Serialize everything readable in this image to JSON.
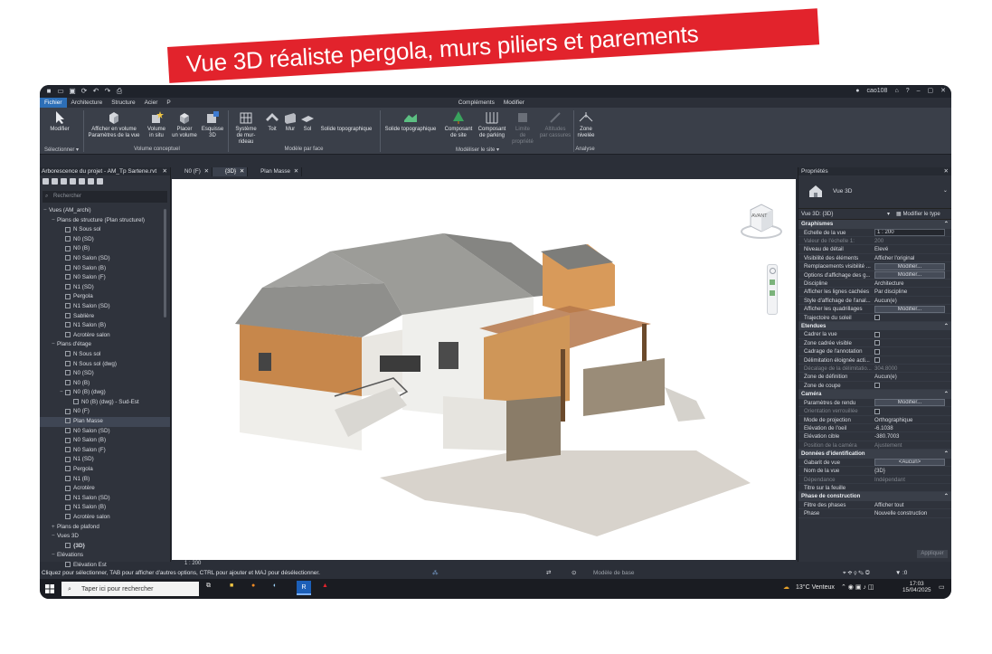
{
  "banner": {
    "text": "Vue 3D réaliste pergola, murs piliers et parements"
  },
  "titlebar": {
    "user": "cao108"
  },
  "ribbon": {
    "tabs": [
      "Fichier",
      "Architecture",
      "Structure",
      "Acier",
      "P",
      "Compléments",
      "Modifier"
    ],
    "buttons": {
      "modifier": "Modifier",
      "afficher_volume": "Afficher en volume",
      "parametres_vue": "Paramètres de la vue",
      "volume_in_situ_1": "Volume",
      "volume_in_situ_2": "in situ",
      "placer_volume_1": "Placer",
      "placer_volume_2": "un volume",
      "esquisse_1": "Esquisse",
      "esquisse_2": "3D",
      "systeme_1": "Système",
      "systeme_2": "de mur-rideau",
      "toit": "Toit",
      "mur": "Mur",
      "sol": "Sol",
      "solide_topo": "Solide topographique",
      "solide_topo2": "Solide topographique",
      "composant_site_1": "Composant",
      "composant_site_2": "de site",
      "composant_parking_1": "Composant",
      "composant_parking_2": "de parking",
      "limite_1": "Limite",
      "limite_2": "de propriété",
      "altitudes_1": "Altitudes",
      "altitudes_2": "par cassures",
      "zone_1": "Zone",
      "zone_2": "nivelée"
    },
    "groups": {
      "selectionner": "Sélectionner ▾",
      "volume_conceptuel": "Volume conceptuel",
      "modele_par_face": "Modèle par face",
      "modeliser_site": "Modéliser le site ▾",
      "analyse": "Analyse"
    }
  },
  "browser": {
    "title": "Arborescence du projet - AM_Tp Sartene.rvt",
    "search_placeholder": "Rechercher",
    "items": [
      {
        "indent": 0,
        "toggle": "−",
        "label": "Vues (AM_archi)",
        "box": false
      },
      {
        "indent": 1,
        "toggle": "−",
        "label": "Plans de structure (Plan structurel)",
        "box": false
      },
      {
        "indent": 2,
        "toggle": "",
        "label": "N Sous sol",
        "box": true
      },
      {
        "indent": 2,
        "toggle": "",
        "label": "N0 (SD)",
        "box": true
      },
      {
        "indent": 2,
        "toggle": "",
        "label": "N0 (B)",
        "box": true
      },
      {
        "indent": 2,
        "toggle": "",
        "label": "N0 Salon (SD)",
        "box": true
      },
      {
        "indent": 2,
        "toggle": "",
        "label": "N0 Salon (B)",
        "box": true
      },
      {
        "indent": 2,
        "toggle": "",
        "label": "N0 Salon (F)",
        "box": true
      },
      {
        "indent": 2,
        "toggle": "",
        "label": "N1 (SD)",
        "box": true
      },
      {
        "indent": 2,
        "toggle": "",
        "label": "Pergola",
        "box": true
      },
      {
        "indent": 2,
        "toggle": "",
        "label": "N1 Salon (SD)",
        "box": true
      },
      {
        "indent": 2,
        "toggle": "",
        "label": "Sablière",
        "box": true
      },
      {
        "indent": 2,
        "toggle": "",
        "label": "N1 Salon (B)",
        "box": true
      },
      {
        "indent": 2,
        "toggle": "",
        "label": "Acrotère salon",
        "box": true
      },
      {
        "indent": 1,
        "toggle": "−",
        "label": "Plans d'étage",
        "box": false
      },
      {
        "indent": 2,
        "toggle": "",
        "label": "N Sous sol",
        "box": true
      },
      {
        "indent": 2,
        "toggle": "",
        "label": "N Sous sol (dwg)",
        "box": true
      },
      {
        "indent": 2,
        "toggle": "",
        "label": "N0 (SD)",
        "box": true
      },
      {
        "indent": 2,
        "toggle": "",
        "label": "N0 (B)",
        "box": true
      },
      {
        "indent": 2,
        "toggle": "−",
        "label": "N0 (B) (dwg)",
        "box": true
      },
      {
        "indent": 3,
        "toggle": "",
        "label": "N0 (B) (dwg) - Sud-Est",
        "box": true
      },
      {
        "indent": 2,
        "toggle": "",
        "label": "N0 (F)",
        "box": true
      },
      {
        "indent": 2,
        "toggle": "",
        "label": "Plan Masse",
        "box": true,
        "selected": true
      },
      {
        "indent": 2,
        "toggle": "",
        "label": "N0 Salon (SD)",
        "box": true
      },
      {
        "indent": 2,
        "toggle": "",
        "label": "N0 Salon (B)",
        "box": true
      },
      {
        "indent": 2,
        "toggle": "",
        "label": "N0 Salon (F)",
        "box": true
      },
      {
        "indent": 2,
        "toggle": "",
        "label": "N1 (SD)",
        "box": true
      },
      {
        "indent": 2,
        "toggle": "",
        "label": "Pergola",
        "box": true
      },
      {
        "indent": 2,
        "toggle": "",
        "label": "N1 (B)",
        "box": true
      },
      {
        "indent": 2,
        "toggle": "",
        "label": "Acrotère",
        "box": true
      },
      {
        "indent": 2,
        "toggle": "",
        "label": "N1 Salon (SD)",
        "box": true
      },
      {
        "indent": 2,
        "toggle": "",
        "label": "N1 Salon (B)",
        "box": true
      },
      {
        "indent": 2,
        "toggle": "",
        "label": "Acrotère salon",
        "box": true
      },
      {
        "indent": 1,
        "toggle": "+",
        "label": "Plans de plafond",
        "box": false
      },
      {
        "indent": 1,
        "toggle": "−",
        "label": "Vues 3D",
        "box": false
      },
      {
        "indent": 2,
        "toggle": "",
        "label": "{3D}",
        "box": true,
        "bold": true
      },
      {
        "indent": 1,
        "toggle": "−",
        "label": "Elévations",
        "box": false
      },
      {
        "indent": 2,
        "toggle": "",
        "label": "Elévation Est",
        "box": true
      }
    ]
  },
  "view_tabs": [
    "N0 (F)",
    "{3D}",
    "Plan Masse"
  ],
  "viewcube": {
    "face": "AVANT"
  },
  "view_status": {
    "scale": "1 : 200"
  },
  "properties": {
    "title": "Propriétés",
    "type_name": "Vue 3D",
    "selector": "Vue 3D: {3D}",
    "edit_type": "Modifier le type",
    "sections": [
      {
        "name": "Graphismes",
        "rows": [
          {
            "k": "Echelle de la vue",
            "v": "1 : 200",
            "kind": "field"
          },
          {
            "k": "Valeur de l'échelle    1:",
            "v": "200",
            "kind": "dim"
          },
          {
            "k": "Niveau de détail",
            "v": "Elevé",
            "kind": "text"
          },
          {
            "k": "Visibilité des éléments",
            "v": "Afficher l'original",
            "kind": "text"
          },
          {
            "k": "Remplacements visibilité ...",
            "v": "Modifier...",
            "kind": "button"
          },
          {
            "k": "Options d'affichage des g...",
            "v": "Modifier...",
            "kind": "button"
          },
          {
            "k": "Discipline",
            "v": "Architecture",
            "kind": "text"
          },
          {
            "k": "Afficher les lignes cachées",
            "v": "Par discipline",
            "kind": "text"
          },
          {
            "k": "Style d'affichage de l'anal...",
            "v": "Aucun(e)",
            "kind": "text"
          },
          {
            "k": "Afficher les quadrillages",
            "v": "Modifier...",
            "kind": "button"
          },
          {
            "k": "Trajectoire du soleil",
            "v": "",
            "kind": "check"
          }
        ]
      },
      {
        "name": "Etendues",
        "rows": [
          {
            "k": "Cadrer la vue",
            "v": "",
            "kind": "check"
          },
          {
            "k": "Zone cadrée visible",
            "v": "",
            "kind": "check"
          },
          {
            "k": "Cadrage de l'annotation",
            "v": "",
            "kind": "check"
          },
          {
            "k": "Délimitation éloignée acti...",
            "v": "",
            "kind": "check"
          },
          {
            "k": "Décalage de la délimitatio...",
            "v": "304.8000",
            "kind": "dim"
          },
          {
            "k": "Zone de définition",
            "v": "Aucun(e)",
            "kind": "text"
          },
          {
            "k": "Zone de coupe",
            "v": "",
            "kind": "check"
          }
        ]
      },
      {
        "name": "Caméra",
        "rows": [
          {
            "k": "Paramètres de rendu",
            "v": "Modifier...",
            "kind": "button"
          },
          {
            "k": "Orientation verrouillée",
            "v": "",
            "kind": "dimcheck"
          },
          {
            "k": "Mode de projection",
            "v": "Orthographique",
            "kind": "text"
          },
          {
            "k": "Elévation de l'oeil",
            "v": "-6.1038",
            "kind": "text"
          },
          {
            "k": "Elévation cible",
            "v": "-380.7003",
            "kind": "text"
          },
          {
            "k": "Position de la caméra",
            "v": "Ajustement",
            "kind": "dim"
          }
        ]
      },
      {
        "name": "Données d'identification",
        "rows": [
          {
            "k": "Gabarit de vue",
            "v": "<Aucun>",
            "kind": "button"
          },
          {
            "k": "Nom de la vue",
            "v": "{3D}",
            "kind": "text"
          },
          {
            "k": "Dépendance",
            "v": "Indépendant",
            "kind": "dim"
          },
          {
            "k": "Titre sur la feuille",
            "v": "",
            "kind": "text"
          }
        ]
      },
      {
        "name": "Phase de construction",
        "rows": [
          {
            "k": "Filtre des phases",
            "v": "Afficher tout",
            "kind": "text"
          },
          {
            "k": "Phase",
            "v": "Nouvelle construction",
            "kind": "text"
          }
        ]
      }
    ],
    "apply": "Appliquer"
  },
  "statusbar": {
    "hint": "Cliquez pour sélectionner, TAB pour afficher d'autres options, CTRL pour ajouter et MAJ pour désélectionner.",
    "model": "Modèle de base",
    "count": ":0"
  },
  "taskbar": {
    "search_placeholder": "Taper ici pour rechercher",
    "weather": "13°C  Venteux",
    "time": "17:03",
    "date": "15/04/2025"
  },
  "colors": {
    "accent": "#2d6fb7",
    "banner": "#e2232c"
  }
}
